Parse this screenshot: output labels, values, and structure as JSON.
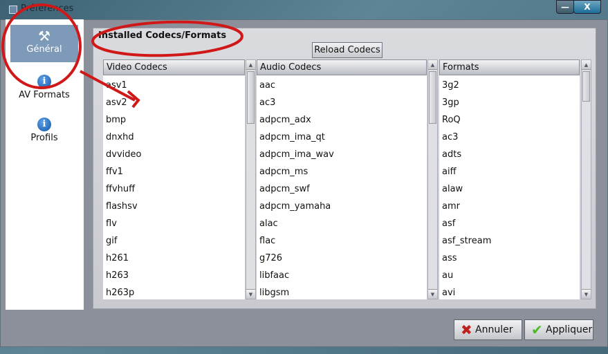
{
  "window": {
    "title": "Préférences",
    "minimize": "—",
    "close": "X"
  },
  "sidebar": {
    "items": [
      {
        "label": "Général",
        "icon": "tools-icon"
      },
      {
        "label": "AV Formats",
        "icon": "info-icon"
      },
      {
        "label": "Profils",
        "icon": "info-icon"
      }
    ]
  },
  "panel": {
    "title": "Installed Codecs/Formats",
    "reload_label": "Reload Codecs"
  },
  "lists": {
    "video": {
      "header": "Video Codecs",
      "items": [
        "asv1",
        "asv2",
        "bmp",
        "dnxhd",
        "dvvideo",
        "ffv1",
        "ffvhuff",
        "flashsv",
        "flv",
        "gif",
        "h261",
        "h263",
        "h263p"
      ]
    },
    "audio": {
      "header": "Audio Codecs",
      "items": [
        "aac",
        "ac3",
        "adpcm_adx",
        "adpcm_ima_qt",
        "adpcm_ima_wav",
        "adpcm_ms",
        "adpcm_swf",
        "adpcm_yamaha",
        "alac",
        "flac",
        "g726",
        "libfaac",
        "libgsm"
      ]
    },
    "formats": {
      "header": "Formats",
      "items": [
        "3g2",
        "3gp",
        "RoQ",
        "ac3",
        "adts",
        "aiff",
        "alaw",
        "amr",
        "asf",
        "asf_stream",
        "ass",
        "au",
        "avi"
      ]
    }
  },
  "footer": {
    "cancel_label": "Annuler",
    "apply_label": "Appliquer"
  }
}
